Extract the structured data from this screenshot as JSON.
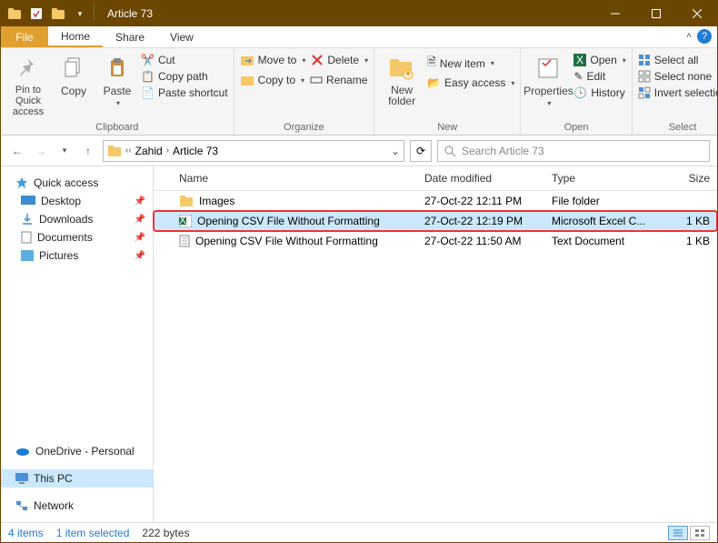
{
  "window": {
    "title": "Article 73"
  },
  "tabs": {
    "file": "File",
    "home": "Home",
    "share": "Share",
    "view": "View"
  },
  "ribbon": {
    "clipboard": {
      "pin": "Pin to Quick access",
      "copy": "Copy",
      "paste": "Paste",
      "cut": "Cut",
      "copy_path": "Copy path",
      "paste_shortcut": "Paste shortcut",
      "label": "Clipboard"
    },
    "organize": {
      "move_to": "Move to",
      "copy_to": "Copy to",
      "delete": "Delete",
      "rename": "Rename",
      "label": "Organize"
    },
    "new": {
      "new_folder": "New folder",
      "new_item": "New item",
      "easy_access": "Easy access",
      "label": "New"
    },
    "open": {
      "properties": "Properties",
      "open": "Open",
      "edit": "Edit",
      "history": "History",
      "label": "Open"
    },
    "select": {
      "all": "Select all",
      "none": "Select none",
      "invert": "Invert selection",
      "label": "Select"
    }
  },
  "breadcrumb": {
    "parts": [
      "Zahid",
      "Article 73"
    ]
  },
  "search": {
    "placeholder": "Search Article 73"
  },
  "sidebar": {
    "quick": "Quick access",
    "items": [
      "Desktop",
      "Downloads",
      "Documents",
      "Pictures"
    ],
    "onedrive": "OneDrive - Personal",
    "thispc": "This PC",
    "network": "Network"
  },
  "columns": {
    "name": "Name",
    "date": "Date modified",
    "type": "Type",
    "size": "Size"
  },
  "rows": [
    {
      "name": "Images",
      "date": "27-Oct-22 12:11 PM",
      "type": "File folder",
      "size": ""
    },
    {
      "name": "Opening CSV File Without Formatting",
      "date": "27-Oct-22 12:19 PM",
      "type": "Microsoft Excel C...",
      "size": "1 KB"
    },
    {
      "name": "Opening CSV File Without Formatting",
      "date": "27-Oct-22 11:50 AM",
      "type": "Text Document",
      "size": "1 KB"
    }
  ],
  "status": {
    "items": "4 items",
    "selected": "1 item selected",
    "bytes": "222 bytes"
  }
}
